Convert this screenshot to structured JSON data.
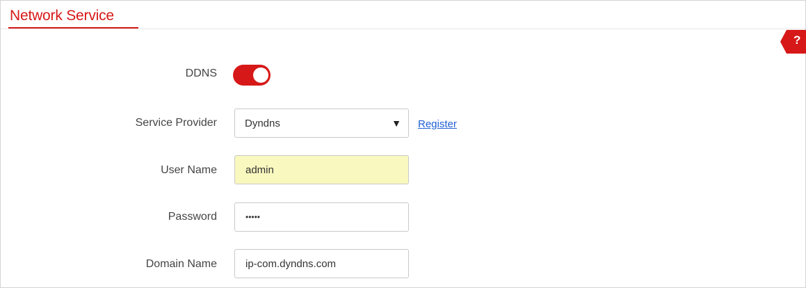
{
  "section": {
    "title": "Network Service"
  },
  "help": {
    "glyph": "?",
    "color": "#d71818"
  },
  "ddns": {
    "label": "DDNS",
    "enabled": true,
    "accent_color": "#d71818"
  },
  "service_provider": {
    "label": "Service Provider",
    "selected": "Dyndns",
    "dropdown_glyph": "▼",
    "register_link": "Register"
  },
  "user_name": {
    "label": "User Name",
    "value": "admin"
  },
  "password": {
    "label": "Password",
    "masked_value": "•••••"
  },
  "domain_name": {
    "label": "Domain Name",
    "value": "ip-com.dyndns.com"
  }
}
